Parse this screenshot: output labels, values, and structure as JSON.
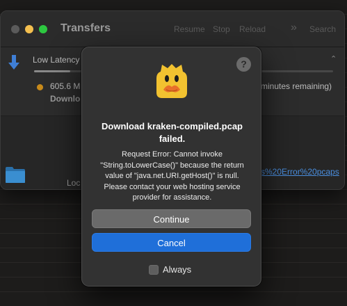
{
  "window": {
    "title": "Transfers",
    "toolbar": {
      "resume": "Resume",
      "stop": "Stop",
      "reload": "Reload",
      "overflow": "»",
      "search": "Search"
    }
  },
  "transfer": {
    "connection_label": "Low Latency",
    "chevron": "⌃⌄",
    "progress_fraction": 0.12,
    "size_text": "605.6 M",
    "remaining_text": "minutes remaining)",
    "status_label": "Downlo"
  },
  "row2": {
    "local_label": "Loc",
    "link_text": "s%20Error%20pcaps"
  },
  "dialog": {
    "help": "?",
    "title": "Download kraken-compiled.pcap failed.",
    "message": "Request Error: Cannot invoke \"String.toLowerCase()\" because the return value of \"java.net.URI.getHost()\" is null. Please contact your web hosting service provider for assistance.",
    "continue_label": "Continue",
    "cancel_label": "Cancel",
    "checkbox_label": "Always"
  },
  "colors": {
    "accent": "#1f6fd9",
    "status_dot": "#c88a1a",
    "link": "#4a8fe0"
  },
  "icons": {
    "app": "cyberduck-duck-icon",
    "download": "download-arrow-icon",
    "folder": "folder-icon",
    "help": "help-icon"
  }
}
